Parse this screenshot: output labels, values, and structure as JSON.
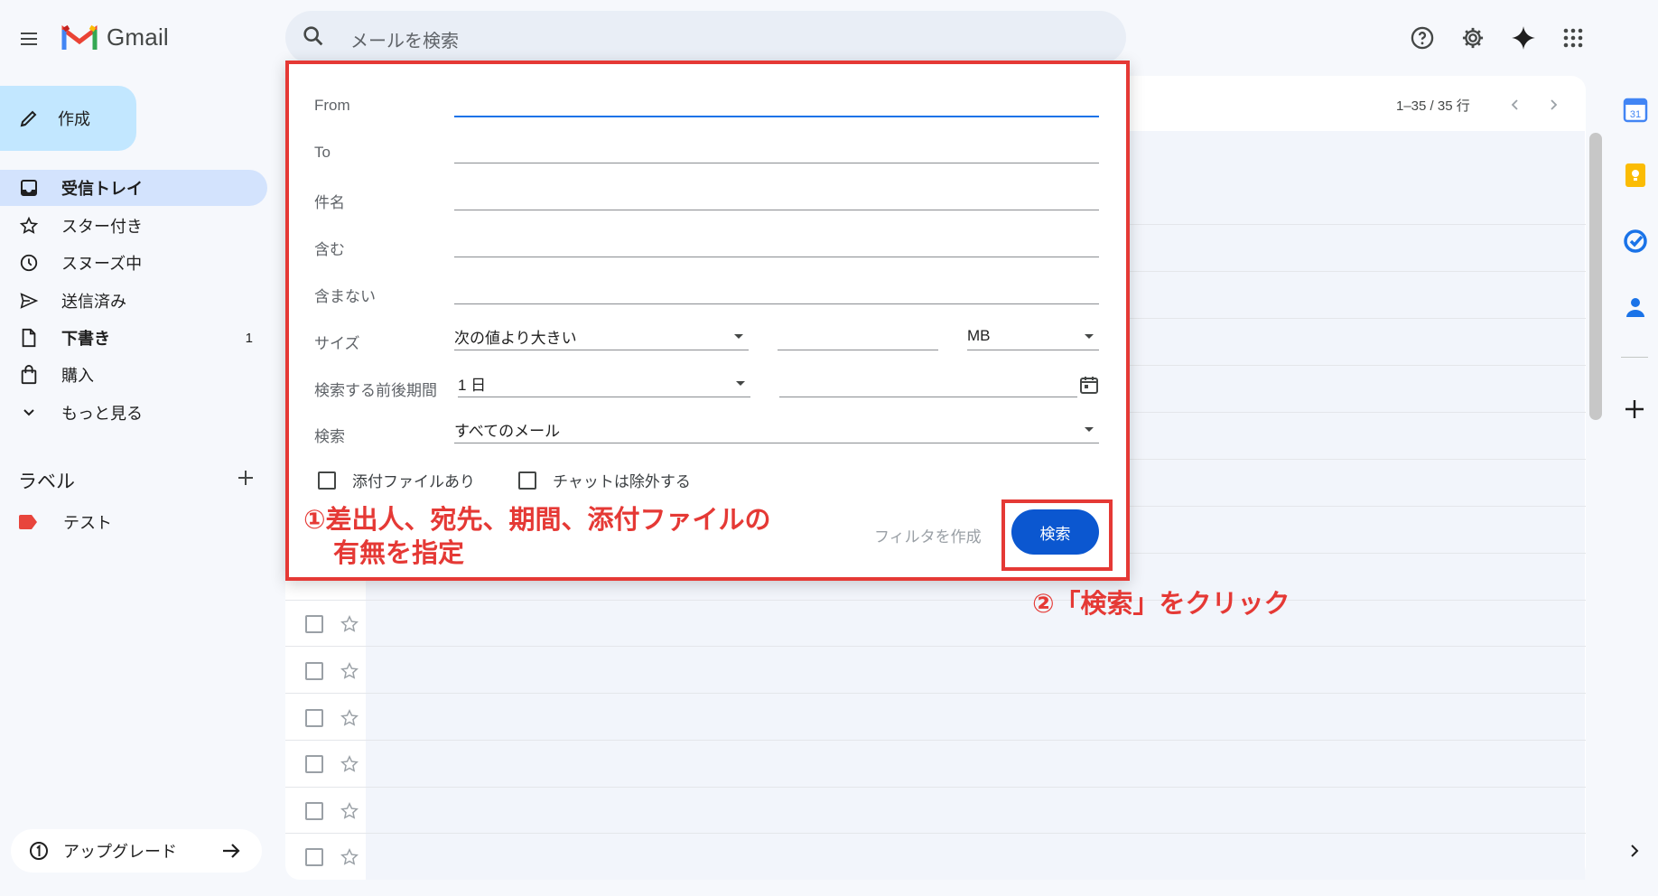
{
  "app": {
    "name": "Gmail"
  },
  "header": {
    "search_placeholder": "メールを検索",
    "icons": [
      "menu-icon",
      "search-icon",
      "help-icon",
      "settings-icon",
      "gemini-icon",
      "apps-icon"
    ]
  },
  "sidebar": {
    "compose_label": "作成",
    "items": [
      {
        "label": "受信トレイ",
        "icon": "inbox-icon",
        "active": true,
        "count": ""
      },
      {
        "label": "スター付き",
        "icon": "star-icon",
        "active": false,
        "count": ""
      },
      {
        "label": "スヌーズ中",
        "icon": "clock-icon",
        "active": false,
        "count": ""
      },
      {
        "label": "送信済み",
        "icon": "send-icon",
        "active": false,
        "count": ""
      },
      {
        "label": "下書き",
        "icon": "draft-icon",
        "active": false,
        "count": "1"
      },
      {
        "label": "購入",
        "icon": "shopping-bag-icon",
        "active": false,
        "count": ""
      },
      {
        "label": "もっと見る",
        "icon": "chevron-down-icon",
        "active": false,
        "count": ""
      }
    ],
    "labels_heading": "ラベル",
    "labels": [
      {
        "name": "テスト",
        "color": "#e8453c"
      }
    ],
    "upgrade_label": "アップグレード"
  },
  "main": {
    "pagination": "1–35 / 35 行"
  },
  "advanced_search": {
    "fields": {
      "from": {
        "label": "From",
        "value": ""
      },
      "to": {
        "label": "To",
        "value": ""
      },
      "subject": {
        "label": "件名",
        "value": ""
      },
      "has_words": {
        "label": "含む",
        "value": ""
      },
      "not_has": {
        "label": "含まない",
        "value": ""
      }
    },
    "size": {
      "label": "サイズ",
      "comparator": "次の値より大きい",
      "value": "",
      "unit": "MB"
    },
    "date_within": {
      "label": "検索する前後期間",
      "value": "1 日",
      "date": ""
    },
    "search_in": {
      "label": "検索",
      "value": "すべてのメール"
    },
    "has_attachment_label": "添付ファイルあり",
    "exclude_chats_label": "チャットは除外する",
    "create_filter_label": "フィルタを作成",
    "search_button_label": "検索"
  },
  "annotations": {
    "note1_line1": "①差出人、宛先、期間、添付ファイルの",
    "note1_line2": "有無を指定",
    "note2": "②「検索」をクリック",
    "highlight_color": "#e53935"
  },
  "colors": {
    "background": "#f6f8fc",
    "compose": "#c2e7ff",
    "active_nav": "#d3e3fd",
    "primary_button": "#0b57d0"
  }
}
